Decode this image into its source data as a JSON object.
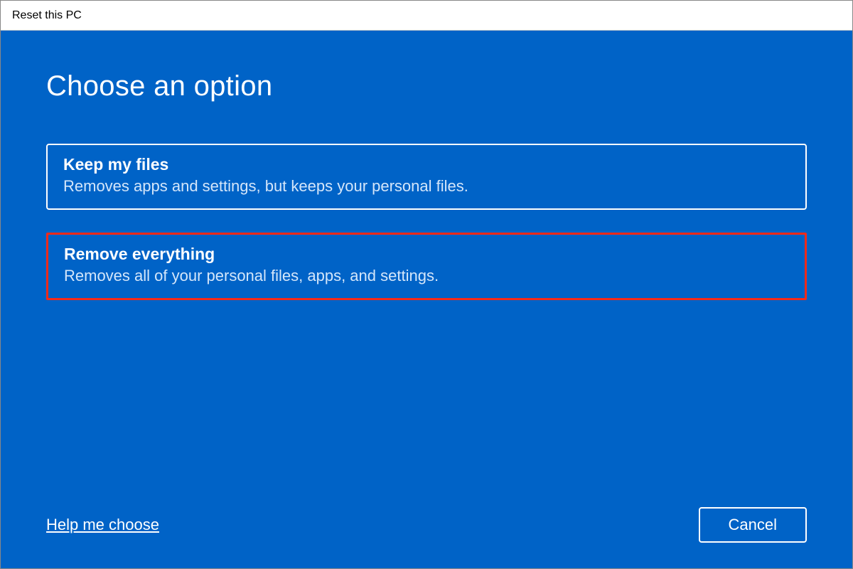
{
  "titlebar": {
    "title": "Reset this PC"
  },
  "main": {
    "heading": "Choose an option",
    "options": [
      {
        "title": "Keep my files",
        "description": "Removes apps and settings, but keeps your personal files."
      },
      {
        "title": "Remove everything",
        "description": "Removes all of your personal files, apps, and settings."
      }
    ]
  },
  "footer": {
    "help_link": "Help me choose",
    "cancel_label": "Cancel"
  }
}
